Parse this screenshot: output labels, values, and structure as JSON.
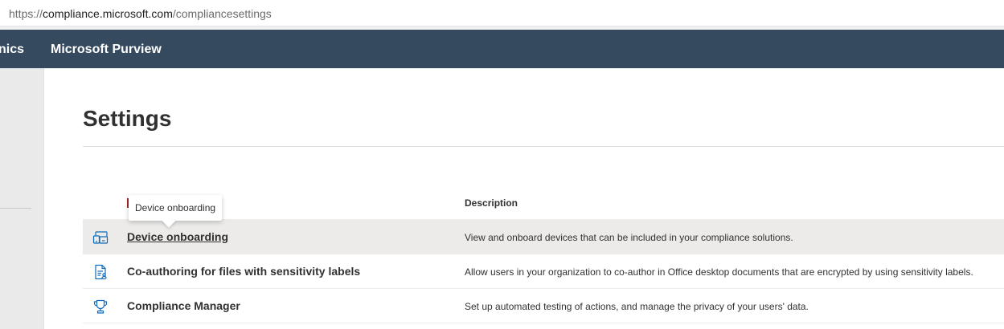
{
  "browser": {
    "url_scheme": "https://",
    "url_host": "compliance.microsoft.com",
    "url_path": "/compliancesettings"
  },
  "topbar": {
    "app_partial": "nics",
    "product_name": "Microsoft Purview"
  },
  "page": {
    "title": "Settings"
  },
  "table": {
    "columns": {
      "name": "",
      "description": "Description"
    },
    "rows": [
      {
        "icon": "device-onboarding-icon",
        "name": "Device onboarding",
        "description": "View and onboard devices that can be included in your compliance solutions."
      },
      {
        "icon": "document-user-icon",
        "name": "Co-authoring for files with sensitivity labels",
        "description": "Allow users in your organization to co-author in Office desktop documents that are encrypted by using sensitivity labels."
      },
      {
        "icon": "trophy-icon",
        "name": "Compliance Manager",
        "description": "Set up automated testing of actions, and manage the privacy of your users' data."
      }
    ]
  },
  "tooltip": {
    "text": "Device onboarding"
  },
  "colors": {
    "topbar": "#354a5f",
    "icon_accent": "#0f6cbd",
    "hover_row": "#edebe9"
  }
}
